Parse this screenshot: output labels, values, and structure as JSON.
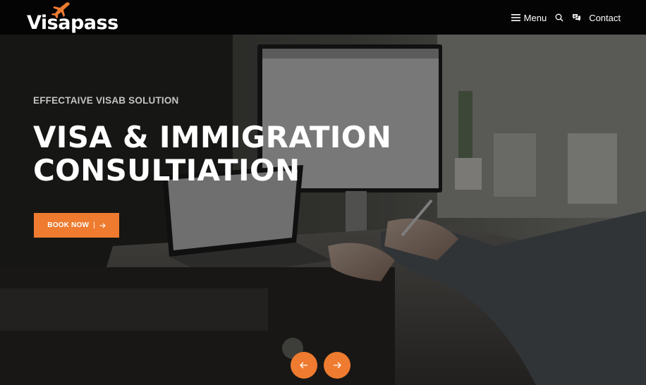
{
  "brand": {
    "name": "Visapass",
    "accent_color": "#ee7b2f",
    "logo_icon": "airplane-icon"
  },
  "nav": {
    "menu_label": "Menu",
    "menu_icon": "hamburger-icon",
    "search_icon": "search-icon",
    "chat_icon": "chat-icon",
    "contact_label": "Contact"
  },
  "hero": {
    "eyebrow": "EFFECTAIVE VISAB SOLUTION",
    "headline_line1": "VISA & IMMIGRATION",
    "headline_line2": "CONSULTIATION",
    "cta_label": "BOOK NOW",
    "cta_separator": "|",
    "cta_icon": "arrow-right-icon"
  },
  "slider": {
    "prev_icon": "arrow-left-icon",
    "next_icon": "arrow-right-icon"
  }
}
